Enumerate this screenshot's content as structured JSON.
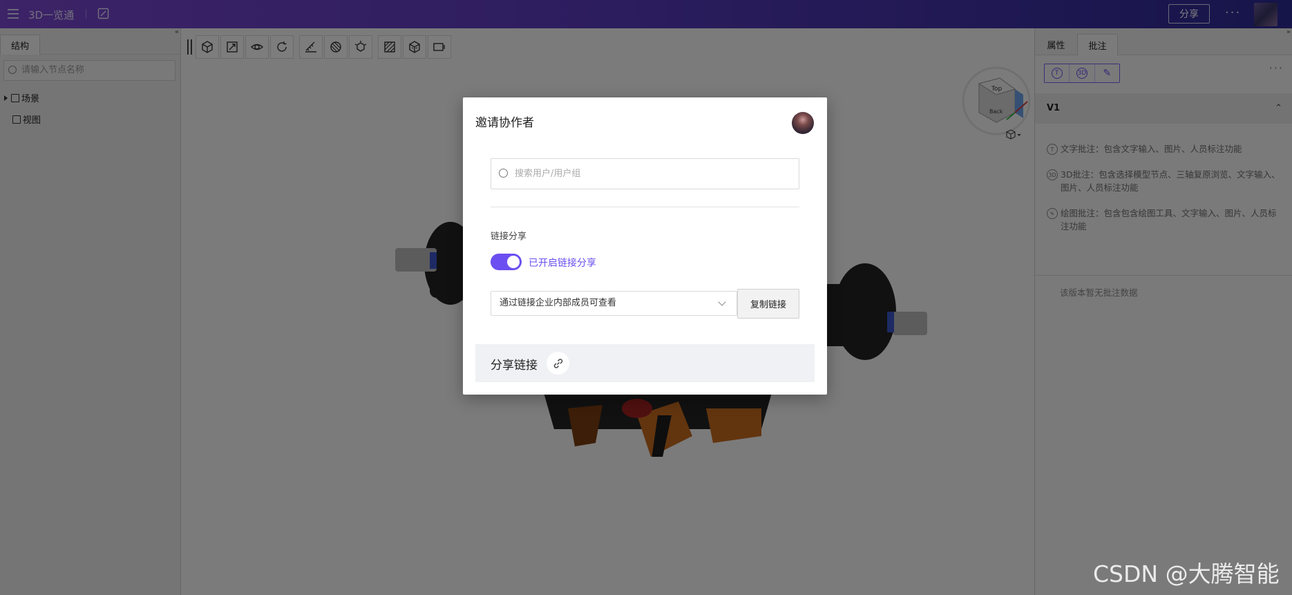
{
  "topbar": {
    "app_title": "3D一览通",
    "share_label": "分享",
    "more_label": "···"
  },
  "left_panel": {
    "tab_label": "结构",
    "collapse_label": "«",
    "search_placeholder": "请输入节点名称",
    "tree": [
      {
        "label": "场景",
        "expandable": true
      },
      {
        "label": "视图",
        "expandable": false
      }
    ]
  },
  "toolbar": {
    "tools": [
      "cube-view",
      "fit-view",
      "eye-view",
      "rotate",
      "measure",
      "section",
      "explode",
      "material",
      "model-display",
      "frame"
    ]
  },
  "right_panel": {
    "tabs": [
      "属性",
      "批注"
    ],
    "active_tab": "批注",
    "collapse_label": "»",
    "tool_labels": [
      "T",
      "3D",
      "✎"
    ],
    "more_label": "···",
    "version": "V1",
    "chevron_label": "⌃",
    "notes": [
      {
        "icon": "T",
        "text": "文字批注：包含文字输入、图片、人员标注功能"
      },
      {
        "icon": "3D",
        "text": "3D批注：包含选择模型节点、三轴复原浏览、文字输入、图片、人员标注功能"
      },
      {
        "icon": "✎",
        "text": "绘图批注：包含包含绘图工具、文字输入、图片、人员标注功能"
      }
    ],
    "empty_text": "该版本暂无批注数据"
  },
  "modal": {
    "title": "邀请协作者",
    "search_placeholder": "搜索用户/用户组",
    "link_share_label": "链接分享",
    "toggle_on": true,
    "toggle_text": "已开启链接分享",
    "permission_value": "通过链接企业内部成员可查看",
    "copy_button": "复制链接",
    "share_link_label": "分享链接"
  },
  "watermark": "CSDN @大腾智能",
  "colors": {
    "accent": "#6b4ff0",
    "topbar_start": "#7a47cf",
    "topbar_end": "#2c2a93"
  }
}
